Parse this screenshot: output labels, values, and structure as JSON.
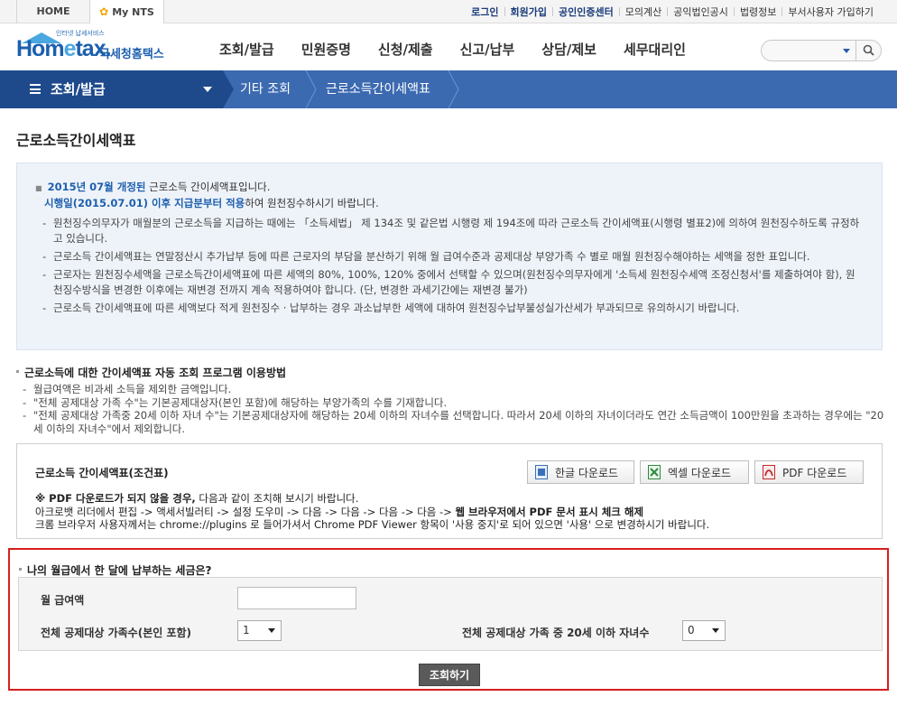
{
  "util": {
    "home": "HOME",
    "mynts": "My NTS",
    "links": [
      "로그인",
      "회원가입",
      "공인인증센터",
      "모의계산",
      "공익법인공시",
      "법령정보",
      "부서사용자 가입하기"
    ]
  },
  "header": {
    "logo_small": "인터넷 납세서비스",
    "logo_main_1": "Hom",
    "logo_main_e": "e",
    "logo_main_2": "tax.",
    "logo_kor": "국세청홈택스",
    "gnb": [
      "조회/발급",
      "민원증명",
      "신청/제출",
      "신고/납부",
      "상담/제보",
      "세무대리인"
    ]
  },
  "subnav": {
    "menu": "조회/발급",
    "crumb1": "기타 조회",
    "crumb2": "근로소득간이세액표"
  },
  "page": {
    "title": "근로소득간이세액표"
  },
  "notice": {
    "line1_blue": "2015년 07월  개정된",
    "line1_rest": " 근로소득 간이세액표입니다.",
    "line2_blue": "시행일(2015.07.01) 이후 지급분부터 적용",
    "line2_rest": "하여 원천징수하시기 바랍니다.",
    "items": [
      "원천징수의무자가 매월분의 근로소득을 지급하는 때에는 「소득세법」 제 134조 및 같은법 시행령 제 194조에 따라 근로소득 간이세액표(시행령 별표2)에 의하여 원천징수하도록 규정하고 있습니다.",
      "근로소득 간이세액표는 연말정산시 추가납부 등에 따른 근로자의 부담을 분산하기 위해 월 급여수준과 공제대상 부양가족 수 별로 매월 원천징수해야하는 세액을 정한 표입니다.",
      "근로자는 원천징수세액을 근로소득간이세액표에 따른 세액의 80%, 100%, 120% 중에서 선택할 수 있으며(원천징수의무자에게 '소득세 원천징수세액 조정신청서'를 제출하여야 함), 원천징수방식을 변경한 이후에는 재변경 전까지 계속 적용하여야 합니다. (단, 변경한 과세기간에는 재변경 불가)",
      "근로소득 간이세액표에 따른 세액보다 적게 원천징수 · 납부하는 경우 과소납부한 세액에 대하여 원천징수납부불성실가산세가 부과되므로 유의하시기 바랍니다."
    ]
  },
  "guide": {
    "title": "근로소득에 대한 간이세액표 자동 조회 프로그램 이용방법",
    "items": [
      "월급여액은  비과세 소득을 제외한 금액입니다.",
      "\"전체 공제대상 가족 수\"는 기본공제대상자(본인 포함)에 해당하는 부양가족의 수를 기재합니다.",
      "\"전체 공제대상 가족중 20세 이하 자녀 수\"는 기본공제대상자에 해당하는 20세 이하의 자녀수를 선택합니다. 따라서 20세 이하의 자녀이더라도 연간 소득금액이 100만원을 초과하는 경우에는 \"20세 이하의 자녀수\"에서 제외합니다."
    ]
  },
  "download": {
    "title": "근로소득 간이세액표(조건표)",
    "hwp": "한글 다운로드",
    "excel": "엑셀 다운로드",
    "pdf": "PDF 다운로드",
    "warn1_bold": "※ PDF 다운로드가 되지 않을 경우,",
    "warn1_rest": " 다음과 같이 조치해 보시기 바랍니다.",
    "warn2_rest": "아크로뱃 리더에서 편집 -> 액세서빌러티 -> 설정 도우미 -> 다음 -> 다음 -> 다음 -> 다음 -> ",
    "warn2_bold": "웹 브라우저에서 PDF 문서 표시 체크 해제",
    "warn3": "크롬 브라우저 사용자께서는 chrome://plugins 로 들어가셔서 Chrome PDF Viewer 항목이 '사용 중지'로 되어 있으면 '사용' 으로 변경하시기 바랍니다."
  },
  "calc": {
    "title": "나의 월급에서 한 달에 납부하는 세금은?",
    "salary_label": "월 급여액",
    "salary_value": "",
    "family_label": "전체 공제대상 가족수(본인 포함)",
    "family_value": "1",
    "children_label": "전체 공제대상 가족 중 20세 이하 자녀수",
    "children_value": "0",
    "submit": "조회하기"
  }
}
